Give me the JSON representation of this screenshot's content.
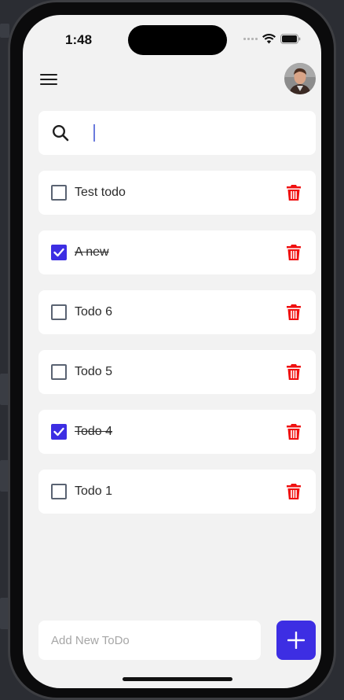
{
  "status_bar": {
    "time": "1:48"
  },
  "header": {
    "menu_icon": "hamburger-menu-icon",
    "avatar": "user-avatar"
  },
  "search": {
    "icon": "search-icon",
    "value": "",
    "placeholder": ""
  },
  "todos": [
    {
      "text": "Test todo",
      "done": false
    },
    {
      "text": "A new",
      "done": true
    },
    {
      "text": "Todo 6",
      "done": false
    },
    {
      "text": "Todo 5",
      "done": false
    },
    {
      "text": "Todo 4",
      "done": true
    },
    {
      "text": "Todo 1",
      "done": false
    }
  ],
  "add_todo": {
    "placeholder": "Add New ToDo",
    "button_icon": "plus-icon"
  },
  "colors": {
    "accent": "#3d2ee3",
    "delete": "#f01010",
    "background": "#f2f2f2",
    "card": "#ffffff"
  }
}
